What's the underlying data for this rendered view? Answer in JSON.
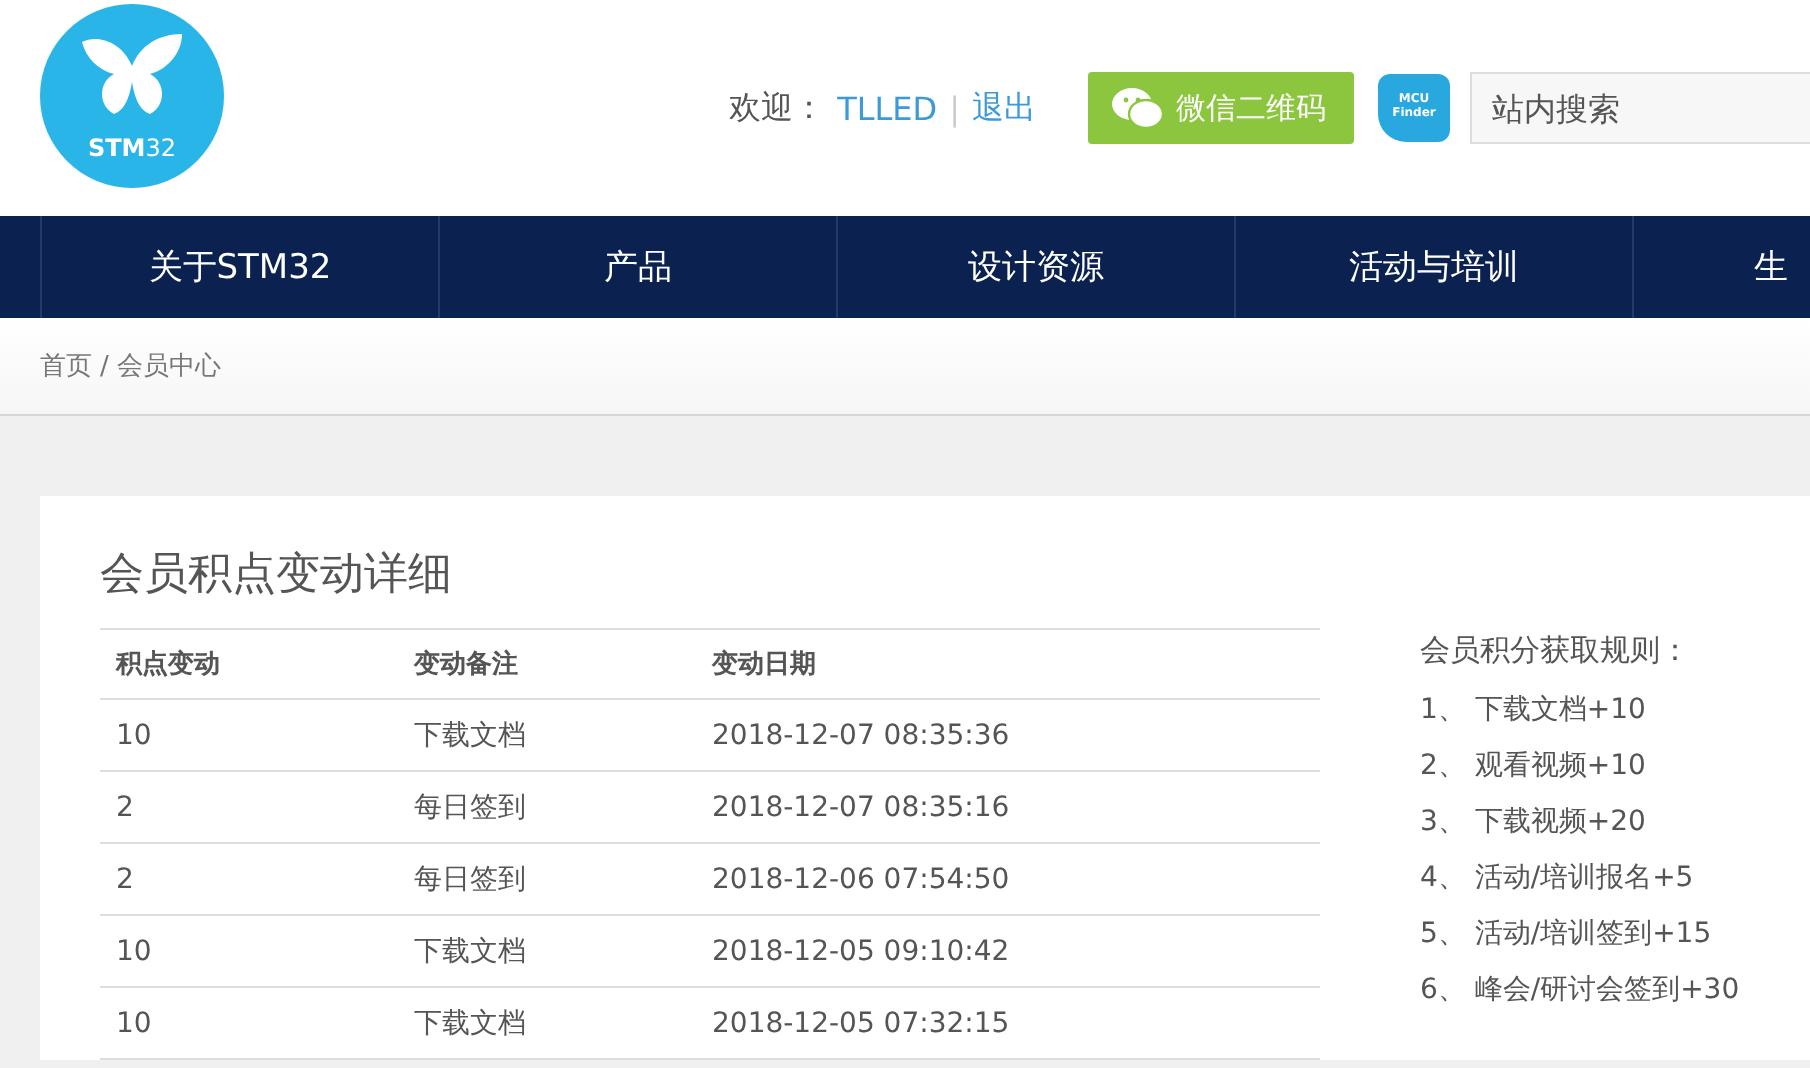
{
  "header": {
    "logo_text": "**STM**32",
    "welcome_label": "欢迎：",
    "username": "TLLED",
    "divider": "|",
    "logout": "退出",
    "wechat_button": "微信二维码",
    "mcu_finder": [
      "MCU",
      "Finder"
    ],
    "search": {
      "placeholder": "站内搜索"
    }
  },
  "nav": {
    "items": [
      {
        "label": "关于STM32"
      },
      {
        "label": "产品"
      },
      {
        "label": "设计资源"
      },
      {
        "label": "活动与培训"
      },
      {
        "label": "生"
      }
    ]
  },
  "breadcrumb": {
    "separator": "/",
    "items": [
      "首页",
      "会员中心"
    ]
  },
  "points": {
    "title": "会员积点变动详细",
    "table": {
      "columns": [
        "积点变动",
        "变动备注",
        "变动日期"
      ],
      "rows": [
        [
          "10",
          "下载文档",
          "2018-12-07 08:35:36"
        ],
        [
          "2",
          "每日签到",
          "2018-12-07 08:35:16"
        ],
        [
          "2",
          "每日签到",
          "2018-12-06 07:54:50"
        ],
        [
          "10",
          "下载文档",
          "2018-12-05 09:10:42"
        ],
        [
          "10",
          "下载文档",
          "2018-12-05 07:32:15"
        ]
      ]
    },
    "rules": {
      "title": "会员积分获取规则：",
      "items": [
        "1、 下载文档+10",
        "2、 观看视频+10",
        "3、 下载视频+20",
        "4、 活动/培训报名+5",
        "5、 活动/培训签到+15",
        "6、 峰会/研讨会签到+30"
      ]
    }
  }
}
